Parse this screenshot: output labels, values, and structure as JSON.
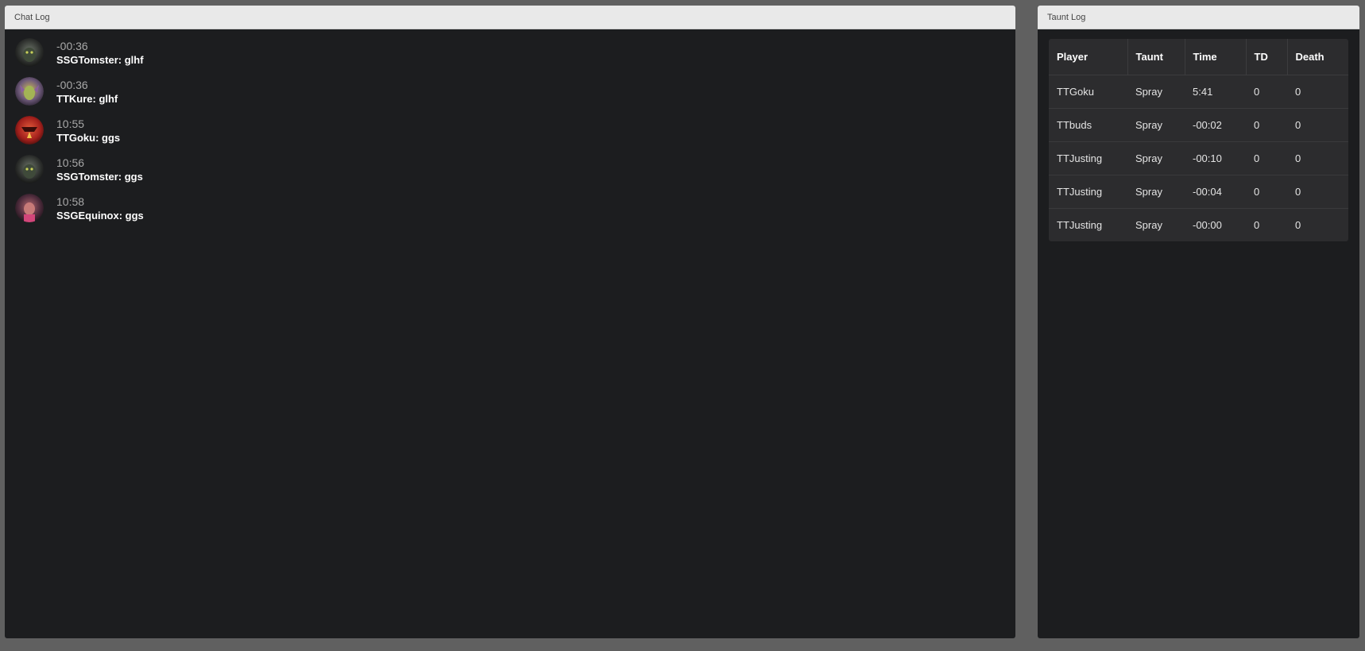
{
  "chat_log": {
    "title": "Chat Log",
    "messages": [
      {
        "time": "-00:36",
        "text": "SSGTomster: glhf",
        "avatar_icon": "hero-portrait-dark-icon"
      },
      {
        "time": "-00:36",
        "text": "TTKure: glhf",
        "avatar_icon": "hero-portrait-green-icon"
      },
      {
        "time": "10:55",
        "text": "TTGoku: ggs",
        "avatar_icon": "hero-portrait-red-icon"
      },
      {
        "time": "10:56",
        "text": "SSGTomster: ggs",
        "avatar_icon": "hero-portrait-dark-icon"
      },
      {
        "time": "10:58",
        "text": "SSGEquinox: ggs",
        "avatar_icon": "hero-portrait-pink-icon"
      }
    ]
  },
  "taunt_log": {
    "title": "Taunt Log",
    "columns": [
      "Player",
      "Taunt",
      "Time",
      "TD",
      "Death"
    ],
    "rows": [
      [
        "TTGoku",
        "Spray",
        "5:41",
        "0",
        "0"
      ],
      [
        "TTbuds",
        "Spray",
        "-00:02",
        "0",
        "0"
      ],
      [
        "TTJusting",
        "Spray",
        "-00:10",
        "0",
        "0"
      ],
      [
        "TTJusting",
        "Spray",
        "-00:04",
        "0",
        "0"
      ],
      [
        "TTJusting",
        "Spray",
        "-00:00",
        "0",
        "0"
      ]
    ]
  },
  "colors": {
    "page_background": "#606060",
    "panel_background": "#1c1d1f",
    "header_background": "#e9e9e9",
    "table_background": "#2c2c2e"
  }
}
